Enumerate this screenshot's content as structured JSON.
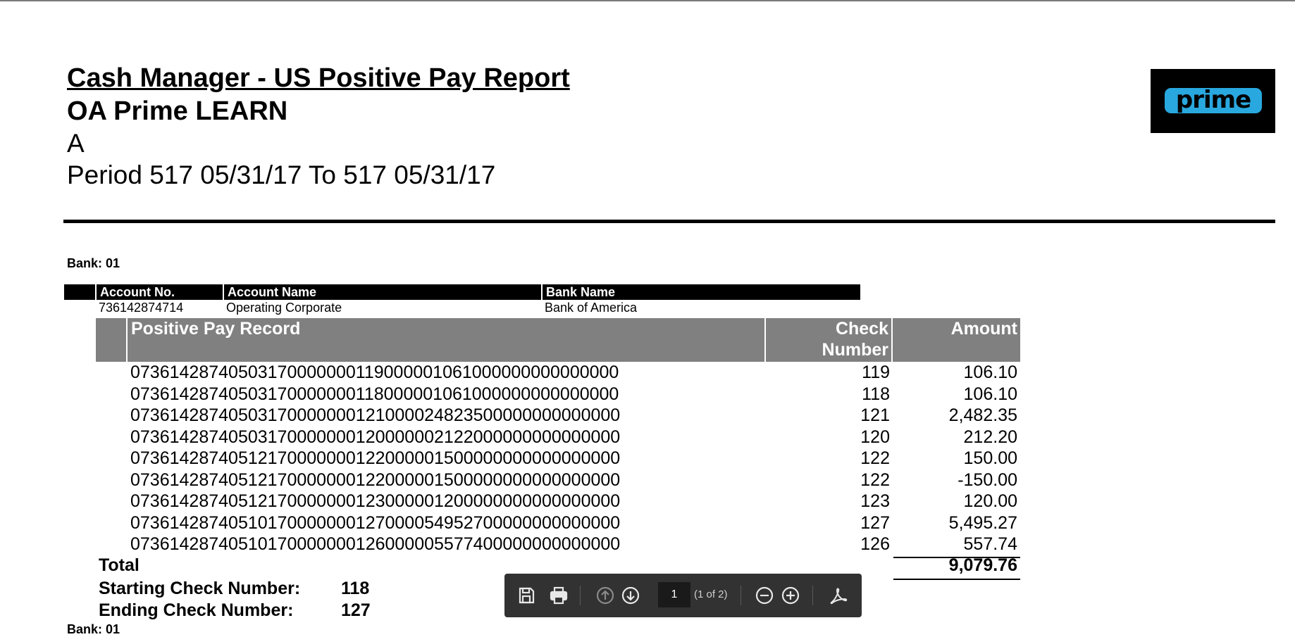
{
  "report": {
    "title": "Cash Manager - US Positive Pay Report",
    "company": "OA Prime LEARN",
    "subtitle": "A",
    "period": "Period 517 05/31/17 To 517 05/31/17",
    "logo_text": "prime"
  },
  "bank": {
    "label": "Bank: 01",
    "next_label": "Bank: 01"
  },
  "account_table": {
    "headers": [
      "Account No.",
      "Account Name",
      "Bank Name"
    ],
    "row": {
      "account_no": "736142874714",
      "account_name": "Operating Corporate",
      "bank_name": "Bank of America"
    }
  },
  "positive_pay": {
    "headers": {
      "record": "Positive Pay Record",
      "check_line1": "Check",
      "check_line2": "Number",
      "amount": "Amount"
    },
    "rows": [
      {
        "record": "07361428740503170000000119000001061000000000000000",
        "check": "119",
        "amount": "106.10"
      },
      {
        "record": "07361428740503170000000118000001061000000000000000",
        "check": "118",
        "amount": "106.10"
      },
      {
        "record": "07361428740503170000000121000024823500000000000000",
        "check": "121",
        "amount": "2,482.35"
      },
      {
        "record": "07361428740503170000000120000002122000000000000000",
        "check": "120",
        "amount": "212.20"
      },
      {
        "record": "07361428740512170000000122000001500000000000000000",
        "check": "122",
        "amount": "150.00"
      },
      {
        "record": "07361428740512170000000122000001500000000000000000",
        "check": "122",
        "amount": "-150.00"
      },
      {
        "record": "07361428740512170000000123000001200000000000000000",
        "check": "123",
        "amount": "120.00"
      },
      {
        "record": "07361428740510170000000127000054952700000000000000",
        "check": "127",
        "amount": "5,495.27"
      },
      {
        "record": "07361428740510170000000126000005577400000000000000",
        "check": "126",
        "amount": "557.74"
      }
    ],
    "total_label": "Total",
    "total_value": "9,079.76",
    "starting_label": "Starting Check Number:",
    "starting_value": "118",
    "ending_label": "Ending Check Number:",
    "ending_value": "127"
  },
  "pdf_toolbar": {
    "page_value": "1",
    "page_total": "(1 of 2)",
    "icons": [
      "save-icon",
      "print-icon",
      "page-up-icon",
      "page-down-icon",
      "zoom-out-icon",
      "zoom-in-icon",
      "acrobat-icon"
    ]
  },
  "colors": {
    "header_bg": "#000000",
    "record_header_bg": "#808080",
    "logo_pill": "#29a8e0",
    "toolbar_bg": "#323232"
  }
}
